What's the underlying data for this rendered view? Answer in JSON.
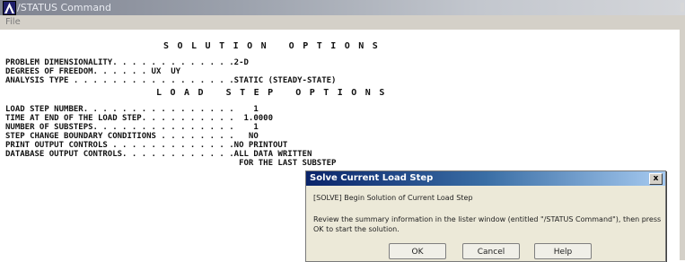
{
  "window": {
    "title": "/STATUS Command",
    "menu_file": "File"
  },
  "listing": {
    "heading1": "SOLUTION OPTIONS",
    "heading2": "LOAD STEP OPTIONS",
    "solution_lines": [
      "PROBLEM DIMENSIONALITY. . . . . . . . . . . . .2-D",
      "DEGREES OF FREEDOM. . . . . . UX  UY",
      "ANALYSIS TYPE . . . . . . . . . . . . . . . . .STATIC (STEADY-STATE)"
    ],
    "load_step_lines": [
      "LOAD STEP NUMBER. . . . . . . . . . . . . . . .    1",
      "TIME AT END OF THE LOAD STEP. . . . . . . . . .  1.0000",
      "NUMBER OF SUBSTEPS. . . . . . . . . . . . . . .    1",
      "STEP CHANGE BOUNDARY CONDITIONS . . . . . . . .   NO",
      "PRINT OUTPUT CONTROLS . . . . . . . . . . . . .NO PRINTOUT",
      "DATABASE OUTPUT CONTROLS. . . . . . . . . . . .ALL DATA WRITTEN",
      "                                                FOR THE LAST SUBSTEP"
    ]
  },
  "dialog": {
    "title": "Solve Current Load Step",
    "close_label": "x",
    "line1": "[SOLVE] Begin Solution of Current Load Step",
    "message": "Review the summary information in the lister window (entitled \"/STATUS Command\"), then press OK to start the solution.",
    "ok_label": "OK",
    "cancel_label": "Cancel",
    "help_label": "Help"
  }
}
